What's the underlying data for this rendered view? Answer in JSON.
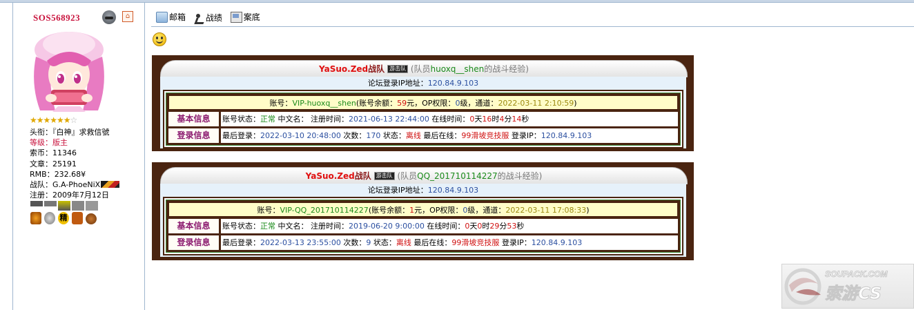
{
  "user": {
    "name": "SOS568923",
    "stars": "★★★★★★",
    "star_empty": "☆",
    "title_label": "头衔：",
    "title_value": "『白神』求救信號",
    "level_label": "等级：",
    "level_value": "版主",
    "coins_label": "索币：",
    "coins_value": "11346",
    "posts_label": "文章：",
    "posts_value": "25191",
    "rmb_label": "RMB：",
    "rmb_value": "232.68¥",
    "team_label": "战队：",
    "team_value": "G.A-PhoeNiX",
    "reg_label": "注册：",
    "reg_value": "2009年7月12日",
    "medal_text": "精",
    "icons": [
      "face-icon",
      "home-icon",
      "flag-icon"
    ]
  },
  "toolbar": {
    "mail": "邮箱",
    "record": "战绩",
    "case": "案底"
  },
  "cards": [
    {
      "team_name": "YaSuo.Zed",
      "team_word": "战队",
      "team_badge": "游击队",
      "member_prefix": "(队员",
      "member_name": "huoxq__shen",
      "member_suffix": "的战斗经验)",
      "ip_label": "论坛登录IP地址：",
      "ip_value": "120.84.9.103",
      "acct_label": "账号：",
      "acct_value": "VIP-huoxq__shen",
      "balance_label": "(账号余额：",
      "balance_value": "59",
      "balance_unit": "元，OP权限：",
      "op_value": "0",
      "op_unit": "级，通道：",
      "channel_value": "2022-03-11 2:10:59",
      "close_paren": ")",
      "basic_label": "基本信息",
      "status_label": "账号状态：",
      "status_value": "正常",
      "cn_label": "中文名：",
      "regtime_label": "注册时间：",
      "regtime_value": "2021-06-13 22:44:00",
      "online_label": "在线时间：",
      "online_d": "0",
      "online_d_unit": "天",
      "online_h": "16",
      "online_h_unit": "时",
      "online_m": "4",
      "online_m_unit": "分",
      "online_s": "14",
      "online_s_unit": "秒",
      "login_label": "登录信息",
      "last_login_label": "最后登录：",
      "last_login_value": "2022-03-10 20:48:00",
      "times_label": "次数：",
      "times_value": "170",
      "state_label": "状态：",
      "state_value": "离线",
      "last_online_label": "最后在线：",
      "last_online_num": "99",
      "last_online_place": "滑坡竞技服",
      "login_ip_label": "登录IP：",
      "login_ip_value": "120.84.9.103"
    },
    {
      "team_name": "YaSuo.Zed",
      "team_word": "战队",
      "team_badge": "游击队",
      "member_prefix": "(队员",
      "member_name": "QQ_201710114227",
      "member_suffix": "的战斗经验)",
      "ip_label": "论坛登录IP地址：",
      "ip_value": "120.84.9.103",
      "acct_label": "账号：",
      "acct_value": "VIP-QQ_201710114227",
      "balance_label": "(账号余额：",
      "balance_value": "1",
      "balance_unit": "元，OP权限：",
      "op_value": "0",
      "op_unit": "级，通道：",
      "channel_value": "2022-03-11 17:08:33",
      "close_paren": ")",
      "basic_label": "基本信息",
      "status_label": "账号状态：",
      "status_value": "正常",
      "cn_label": "中文名：",
      "regtime_label": "注册时间：",
      "regtime_value": "2019-06-20 9:00:00",
      "online_label": "在线时间：",
      "online_d": "0",
      "online_d_unit": "天",
      "online_h": "0",
      "online_h_unit": "时",
      "online_m": "29",
      "online_m_unit": "分",
      "online_s": "53",
      "online_s_unit": "秒",
      "login_label": "登录信息",
      "last_login_label": "最后登录：",
      "last_login_value": "2022-03-13 23:55:00",
      "times_label": "次数：",
      "times_value": "9",
      "state_label": "状态：",
      "state_value": "离线",
      "last_online_label": "最后在线：",
      "last_online_num": "99",
      "last_online_place": "滑坡竞技服",
      "login_ip_label": "登录IP：",
      "login_ip_value": "120.84.9.103"
    }
  ],
  "watermark": {
    "text1": "SOUPACK.COM",
    "text2": "索游CS"
  },
  "colors": {
    "card_frame": "#4a2410",
    "username": "#c8123c",
    "link_blue": "#2b4fa0",
    "ok_green": "#1a8a1a",
    "alert_red": "#d01010",
    "label_purple": "#8b1a6f",
    "header_yellow": "#fffdc8"
  }
}
